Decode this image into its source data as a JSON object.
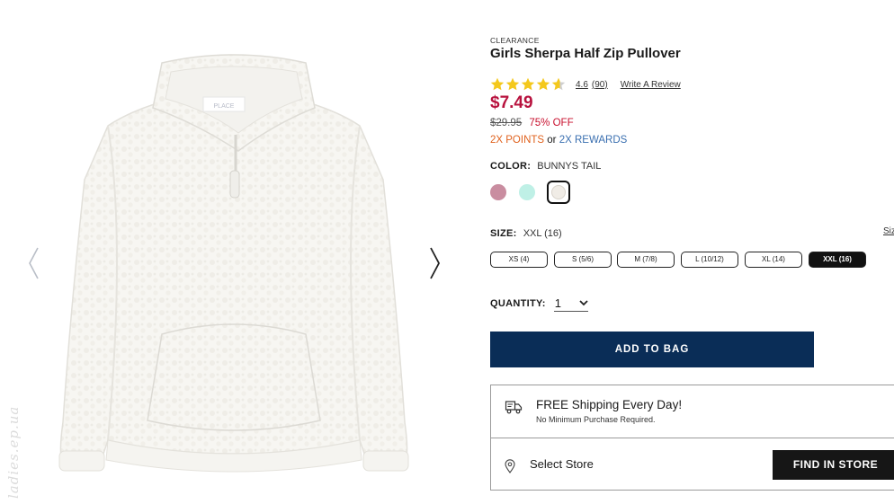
{
  "product": {
    "badge": "CLEARANCE",
    "title": "Girls Sherpa Half Zip Pullover",
    "rating": 4.6,
    "rating_text": "4.6",
    "review_count": "(90)",
    "write_review": "Write A Review",
    "price": "$7.49",
    "original_price": "$29.95",
    "percent_off": "75% OFF",
    "points": "2X POINTS",
    "points_or": "or",
    "rewards": "2X REWARDS",
    "image_logo_text": "PLACE"
  },
  "color": {
    "label": "COLOR:",
    "selected": "BUNNYS TAIL",
    "swatches": [
      {
        "name": "pink",
        "hex": "#c98da0"
      },
      {
        "name": "mint",
        "hex": "#bff0e6"
      },
      {
        "name": "bunnys-tail",
        "hex": "#f0ece6",
        "selected": true
      }
    ]
  },
  "size": {
    "label": "SIZE:",
    "selected": "XXL (16)",
    "chart_link": "Siz",
    "options": [
      "XS (4)",
      "S (5/6)",
      "M (7/8)",
      "L (10/12)",
      "XL (14)",
      "XXL (16)"
    ],
    "selected_index": 5
  },
  "quantity": {
    "label": "QUANTITY:",
    "value": "1"
  },
  "actions": {
    "add_to_bag": "ADD TO BAG",
    "find_in_store": "FIND IN STORE"
  },
  "shipping": {
    "title": "FREE Shipping Every Day!",
    "subtitle": "No Minimum Purchase Required.",
    "select_store": "Select Store"
  },
  "watermark": "ladies.ep.ua",
  "colors": {
    "price_red": "#b8123e",
    "points_orange": "#e0621e",
    "rewards_blue": "#3a6fb0",
    "add_button_navy": "#0a2d57",
    "find_button": "#161616",
    "star_gold": "#f4c81c"
  },
  "icons": {
    "prev": "chevron-left-icon",
    "next": "chevron-right-icon",
    "truck": "truck-icon",
    "pin": "location-pin-icon",
    "qty": "chevron-down-icon"
  }
}
